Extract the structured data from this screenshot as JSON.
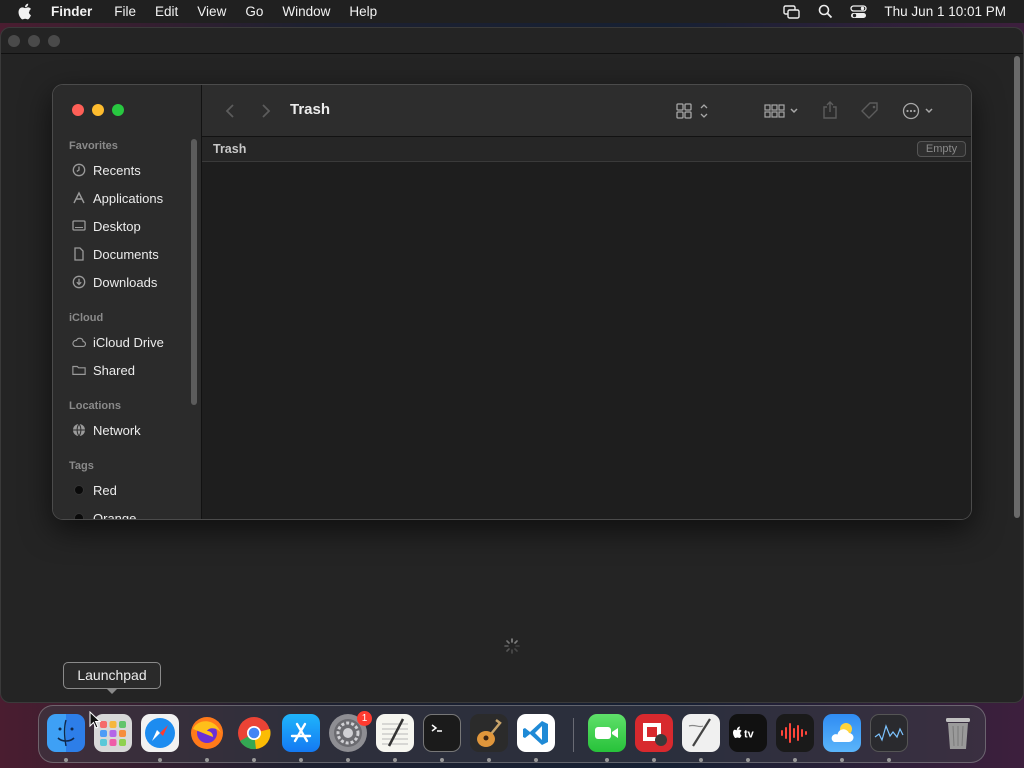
{
  "menubar": {
    "app": "Finder",
    "items": [
      "File",
      "Edit",
      "View",
      "Go",
      "Window",
      "Help"
    ],
    "clock": "Thu Jun 1  10:01 PM",
    "status_icons": [
      "screen-mirroring-icon",
      "spotlight-search-icon",
      "control-center-icon"
    ]
  },
  "finder": {
    "title": "Trash",
    "path_label": "Trash",
    "empty_button": "Empty",
    "sidebar": {
      "favorites_heading": "Favorites",
      "favorites": [
        {
          "label": "Recents",
          "icon": "clock-icon"
        },
        {
          "label": "Applications",
          "icon": "applications-icon"
        },
        {
          "label": "Desktop",
          "icon": "desktop-icon"
        },
        {
          "label": "Documents",
          "icon": "document-icon"
        },
        {
          "label": "Downloads",
          "icon": "download-icon"
        }
      ],
      "icloud_heading": "iCloud",
      "icloud": [
        {
          "label": "iCloud Drive",
          "icon": "cloud-icon"
        },
        {
          "label": "Shared",
          "icon": "shared-folder-icon"
        }
      ],
      "locations_heading": "Locations",
      "locations": [
        {
          "label": "Network",
          "icon": "globe-icon"
        }
      ],
      "tags_heading": "Tags",
      "tags": [
        {
          "label": "Red"
        },
        {
          "label": "Orange"
        }
      ]
    }
  },
  "tooltip": "Launchpad",
  "dock": {
    "apps": [
      "Finder",
      "Launchpad",
      "Safari",
      "Firefox",
      "Chrome",
      "App Store",
      "System Settings",
      "TextEdit",
      "Terminal",
      "GarageBand",
      "Visual Studio Code",
      "FaceTime",
      "Photo Booth",
      "Script Editor",
      "Apple TV",
      "Voice Memos",
      "Weather",
      "Activity Monitor",
      "Trash"
    ],
    "system_settings_badge": "1"
  },
  "colors": {
    "close": "#fe5f57",
    "minimize": "#febc2e",
    "zoom": "#28c840",
    "badge": "#ff3b30"
  }
}
